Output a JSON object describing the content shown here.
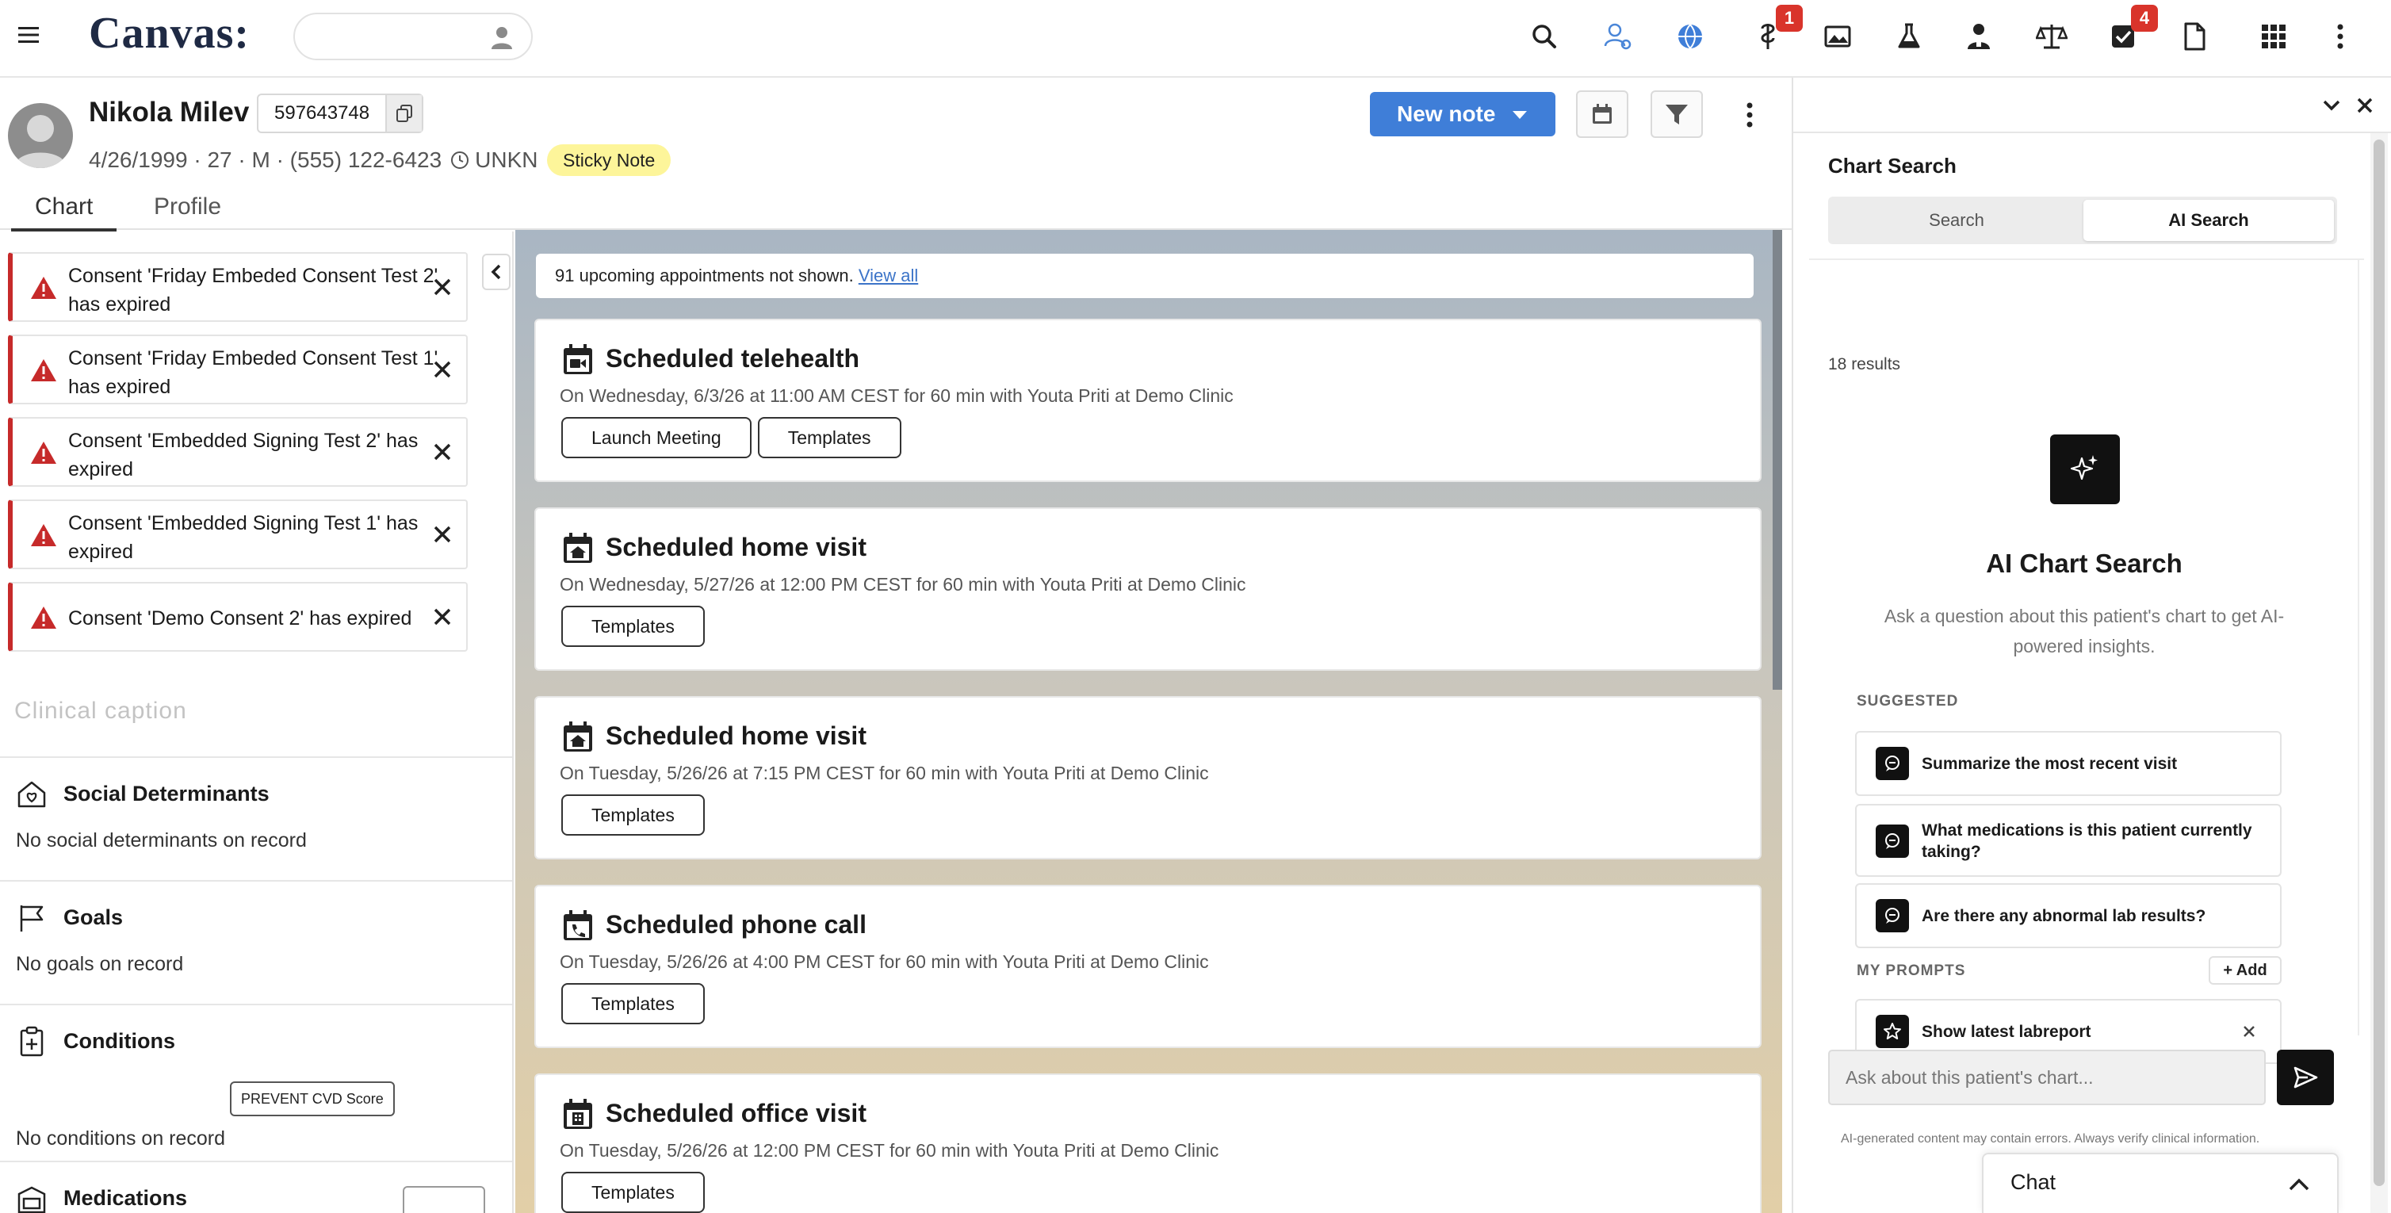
{
  "app": {
    "logo": "Canvas"
  },
  "topbar": {
    "search_placeholder": "",
    "badges": {
      "prescribe": "1",
      "tasks": "4"
    }
  },
  "patient": {
    "name": "Nikola Milev",
    "mrn": "597643748",
    "meta": "4/26/1999 · 27 · M · (555) 122-6423",
    "timezone": "UNKN",
    "sticky_note": "Sticky Note"
  },
  "header": {
    "new_note_label": "New note"
  },
  "tabs": {
    "chart": "Chart",
    "profile": "Profile"
  },
  "alerts": [
    {
      "message": "Consent 'Friday Embeded Consent Test 2' has expired"
    },
    {
      "message": "Consent 'Friday Embeded Consent Test 1' has expired"
    },
    {
      "message": "Consent 'Embedded Signing Test 2' has expired"
    },
    {
      "message": "Consent 'Embedded Signing Test 1' has expired"
    },
    {
      "message": "Consent 'Demo Consent 2' has expired"
    }
  ],
  "left": {
    "clinical_caption": "Clinical caption",
    "social": {
      "title": "Social Determinants",
      "empty": "No social determinants on record"
    },
    "goals": {
      "title": "Goals",
      "empty": "No goals on record"
    },
    "conditions": {
      "title": "Conditions",
      "prevent_button": "PREVENT CVD Score",
      "empty": "No conditions on record"
    },
    "medications": {
      "title": "Medications"
    }
  },
  "timeline": {
    "upcoming_text": "91 upcoming appointments not shown. ",
    "view_all": "View all",
    "appointments": [
      {
        "title": "Scheduled telehealth",
        "detail": "On Wednesday, 6/3/26 at 11:00 AM CEST for 60 min with Youta Priti at Demo Clinic",
        "launch": "Launch Meeting",
        "templates": "Templates"
      },
      {
        "title": "Scheduled home visit",
        "detail": "On Wednesday, 5/27/26 at 12:00 PM CEST for 60 min with Youta Priti at Demo Clinic",
        "templates": "Templates"
      },
      {
        "title": "Scheduled home visit",
        "detail": "On Tuesday, 5/26/26 at 7:15 PM CEST for 60 min with Youta Priti at Demo Clinic",
        "templates": "Templates"
      },
      {
        "title": "Scheduled phone call",
        "detail": "On Tuesday, 5/26/26 at 4:00 PM CEST for 60 min with Youta Priti at Demo Clinic",
        "templates": "Templates"
      },
      {
        "title": "Scheduled office visit",
        "detail": "On Tuesday, 5/26/26 at 12:00 PM CEST for 60 min with Youta Priti at Demo Clinic",
        "templates": "Templates"
      }
    ]
  },
  "chart_search": {
    "title": "Chart Search",
    "tab_search": "Search",
    "tab_ai": "AI Search",
    "results": "18 results",
    "ai_heading": "AI Chart Search",
    "ai_desc": "Ask a question about this patient's chart to get AI-powered insights.",
    "suggested_label": "SUGGESTED",
    "suggested": [
      "Summarize the most recent visit",
      "What medications is this patient currently taking?",
      "Are there any abnormal lab results?"
    ],
    "my_prompts_label": "MY PROMPTS",
    "add_label": "+ Add",
    "my_prompts": [
      "Show latest labreport"
    ],
    "input_placeholder": "Ask about this patient's chart...",
    "disclaimer": "AI-generated content may contain errors. Always verify clinical information."
  },
  "chat": {
    "label": "Chat"
  }
}
